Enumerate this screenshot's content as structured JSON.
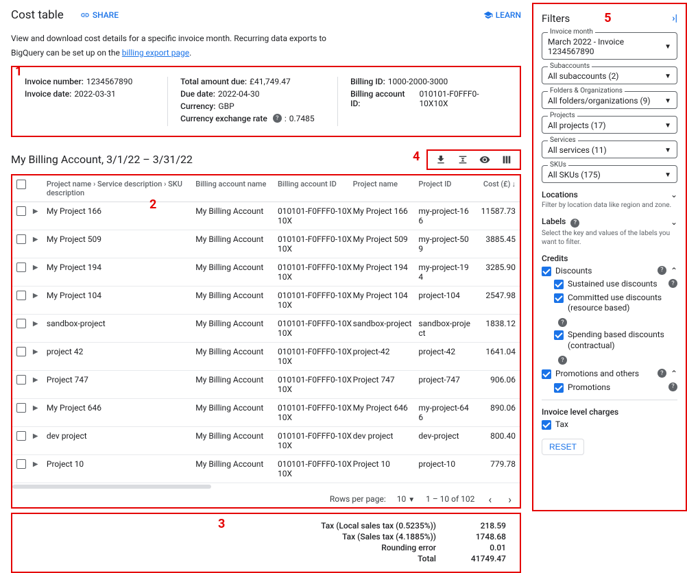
{
  "header": {
    "title": "Cost table",
    "share": "SHARE",
    "learn": "LEARN"
  },
  "intro": {
    "line1": "View and download cost details for a specific invoice month. Recurring data exports to",
    "line2a": "BigQuery can be set up on the ",
    "line2_link": "billing export page",
    "line2b": "."
  },
  "annotations": {
    "a1": "1",
    "a2": "2",
    "a3": "3",
    "a4": "4",
    "a5": "5"
  },
  "invoice": {
    "number_label": "Invoice number:",
    "number": "1234567890",
    "date_label": "Invoice date:",
    "date": "2022-03-31",
    "total_label": "Total amount due:",
    "total": "£41,749.47",
    "due_label": "Due date:",
    "due": "2022-04-30",
    "currency_label": "Currency:",
    "currency": "GBP",
    "fx_label": "Currency exchange rate",
    "fx": "0.7485",
    "billing_id_label": "Billing ID:",
    "billing_id": "1000-2000-3000",
    "billing_acct_label": "Billing account ID:",
    "billing_acct": "010101-F0FFF0-10X10X"
  },
  "account": {
    "title": "My Billing Account, 3/1/22 – 3/31/22"
  },
  "table": {
    "headers": {
      "nested": "Project name › Service description › SKU description",
      "ban": "Billing account name",
      "baid": "Billing account ID",
      "pn": "Project name",
      "pid": "Project ID",
      "cost": "Cost (£)"
    },
    "rows": [
      {
        "pname": "My Project 166",
        "ban": "My Billing Account",
        "baid": "010101-F0FFF0-10X10X",
        "pn": "My Project 166",
        "pid": "my-project-166",
        "cost": "11587.73"
      },
      {
        "pname": "My Project 509",
        "ban": "My Billing Account",
        "baid": "010101-F0FFF0-10X10X",
        "pn": "My Project 509",
        "pid": "my-project-509",
        "cost": "3885.45"
      },
      {
        "pname": "My Project 194",
        "ban": "My Billing Account",
        "baid": "010101-F0FFF0-10X10X",
        "pn": "My Project 194",
        "pid": "my-project-194",
        "cost": "3285.90"
      },
      {
        "pname": "My Project 104",
        "ban": "My Billing Account",
        "baid": "010101-F0FFF0-10X10X",
        "pn": "My Project 104",
        "pid": "project-104",
        "cost": "2547.98"
      },
      {
        "pname": "sandbox-project",
        "ban": "My Billing Account",
        "baid": "010101-F0FFF0-10X10X",
        "pn": "sandbox-project",
        "pid": "sandbox-project",
        "cost": "1838.12"
      },
      {
        "pname": "project 42",
        "ban": "My Billing Account",
        "baid": "010101-F0FFF0-10X10X",
        "pn": "project-42",
        "pid": "project-42",
        "cost": "1641.04"
      },
      {
        "pname": "Project 747",
        "ban": "My Billing Account",
        "baid": "010101-F0FFF0-10X10X",
        "pn": "Project 747",
        "pid": "project-747",
        "cost": "906.06"
      },
      {
        "pname": "My Project 646",
        "ban": "My Billing Account",
        "baid": "010101-F0FFF0-10X10X",
        "pn": "My Project 646",
        "pid": "my-project-646",
        "cost": "890.06"
      },
      {
        "pname": "dev project",
        "ban": "My Billing Account",
        "baid": "010101-F0FFF0-10X10X",
        "pn": "dev project",
        "pid": "dev-project",
        "cost": "800.40"
      },
      {
        "pname": "Project 10",
        "ban": "My Billing Account",
        "baid": "010101-F0FFF0-10X10X",
        "pn": "Project 10",
        "pid": "project-10",
        "cost": "779.78"
      }
    ],
    "pager": {
      "rpp_label": "Rows per page:",
      "rpp": "10",
      "range": "1 – 10 of 102"
    }
  },
  "totals": {
    "tax1_label": "Tax (Local sales tax (0.5235%))",
    "tax1": "218.59",
    "tax2_label": "Tax (Sales tax (4.1885%))",
    "tax2": "1748.68",
    "round_label": "Rounding error",
    "round": "0.01",
    "total_label": "Total",
    "total": "41749.47"
  },
  "filters": {
    "title": "Filters",
    "invoice_month": {
      "label": "Invoice month",
      "value": "March 2022 - Invoice 1234567890"
    },
    "subaccounts": {
      "label": "Subaccounts",
      "value": "All subaccounts (2)"
    },
    "folders": {
      "label": "Folders & Organizations",
      "value": "All folders/organizations (9)"
    },
    "projects": {
      "label": "Projects",
      "value": "All projects (17)"
    },
    "services": {
      "label": "Services",
      "value": "All services (11)"
    },
    "skus": {
      "label": "SKUs",
      "value": "All SKUs (175)"
    },
    "locations": {
      "label": "Locations",
      "desc": "Filter by location data like region and zone."
    },
    "labels": {
      "label": "Labels",
      "desc": "Select the key and values of the labels you want to filter."
    },
    "credits": {
      "title": "Credits",
      "discounts": "Discounts",
      "sustained": "Sustained use discounts",
      "committed": "Committed use discounts (resource based)",
      "spending": "Spending based discounts (contractual)",
      "promo_others": "Promotions and others",
      "promotions": "Promotions"
    },
    "invoice_charges": {
      "title": "Invoice level charges",
      "tax": "Tax"
    },
    "reset": "RESET"
  }
}
